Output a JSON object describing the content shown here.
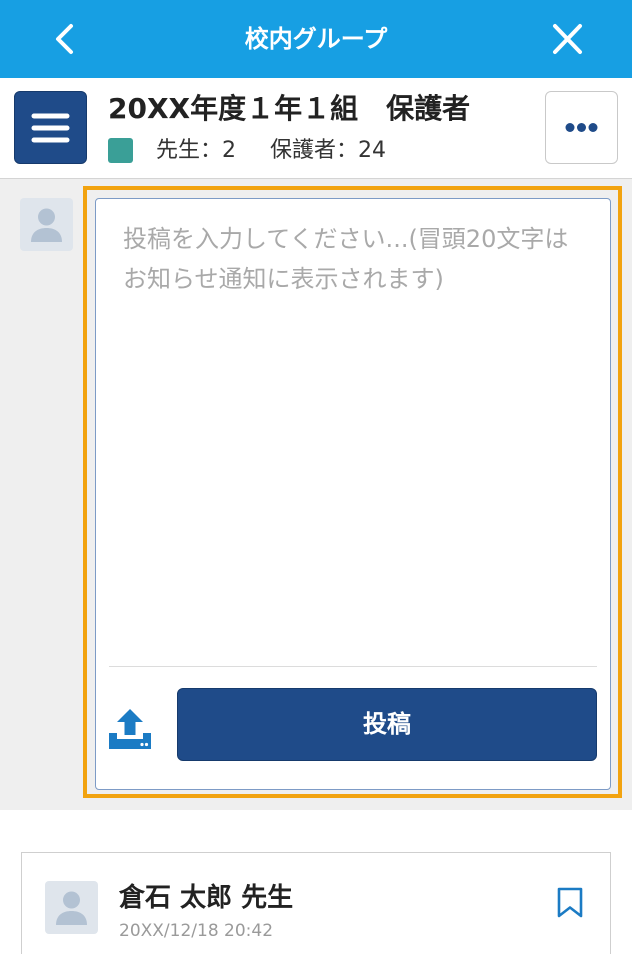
{
  "topbar": {
    "title": "校内グループ",
    "back_icon": "chevron-left-icon",
    "close_icon": "close-icon"
  },
  "group": {
    "name": "20XX年度１年１組　保護者",
    "menu_icon": "hamburger-menu-icon",
    "more_icon": "more-dots-icon",
    "teachers": "先生：2",
    "parents": "保護者：24"
  },
  "composer": {
    "avatar_icon": "person-icon",
    "placeholder": "投稿を入力してください...(冒頭20文字はお知らせ通知に表示されます)",
    "value": "",
    "upload_icon": "upload-icon",
    "post_label": "投稿"
  },
  "posts": [
    {
      "avatar_icon": "person-icon",
      "author": "倉石 太郎 先生",
      "timestamp": "20XX/12/18 20:42",
      "bookmark_icon": "bookmark-icon"
    }
  ],
  "colors": {
    "header_bg": "#179fe3",
    "primary": "#1f4b89",
    "teal": "#3a9f97",
    "highlight": "#f2a30f",
    "page_bg": "#efefef",
    "icon_blue": "#1b7bc4"
  }
}
